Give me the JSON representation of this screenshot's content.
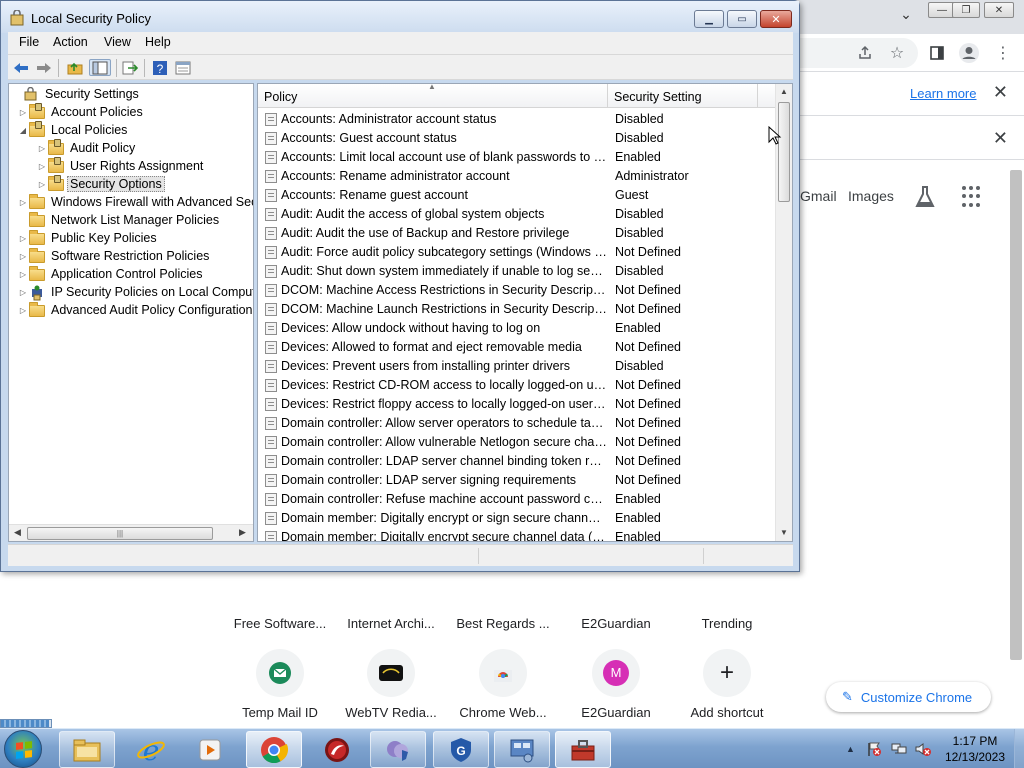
{
  "chrome": {
    "learn_more": "Learn more",
    "gmail": "Gmail",
    "images": "Images",
    "shortcuts": [
      {
        "label": "Free Software..."
      },
      {
        "label": "Internet Archi..."
      },
      {
        "label": "Best Regards ..."
      },
      {
        "label": "E2Guardian"
      },
      {
        "label": "Trending"
      },
      {
        "label": "Temp Mail ID"
      },
      {
        "label": "WebTV Redia..."
      },
      {
        "label": "Chrome Web..."
      },
      {
        "label": "E2Guardian",
        "initial": "M"
      },
      {
        "label": "Add shortcut",
        "icon": "+"
      }
    ],
    "customize": "Customize Chrome"
  },
  "mmc": {
    "title": "Local Security Policy",
    "menu": [
      "File",
      "Action",
      "View",
      "Help"
    ],
    "tree": [
      {
        "label": "Security Settings",
        "arrow": "◢",
        "icon": "root-icon"
      },
      {
        "label": "Account Policies",
        "arrow": "▷",
        "icon": "folder-icon"
      },
      {
        "label": "Local Policies",
        "arrow": "◢",
        "icon": "folder-icon"
      },
      {
        "label": "Audit Policy",
        "arrow": "▷",
        "icon": "folder-icon"
      },
      {
        "label": "User Rights Assignment",
        "arrow": "▷",
        "icon": "folder-icon"
      },
      {
        "label": "Security Options",
        "arrow": "▷",
        "icon": "folder-icon",
        "selected": true
      },
      {
        "label": "Windows Firewall with Advanced Securi",
        "arrow": "▷",
        "icon": "folder-icon"
      },
      {
        "label": "Network List Manager Policies",
        "arrow": "",
        "icon": "folder-icon"
      },
      {
        "label": "Public Key Policies",
        "arrow": "▷",
        "icon": "folder-icon"
      },
      {
        "label": "Software Restriction Policies",
        "arrow": "▷",
        "icon": "folder-icon"
      },
      {
        "label": "Application Control Policies",
        "arrow": "▷",
        "icon": "folder-icon"
      },
      {
        "label": "IP Security Policies on Local Compute",
        "arrow": "▷",
        "icon": "ipsec-icon"
      },
      {
        "label": "Advanced Audit Policy Configuration",
        "arrow": "▷",
        "icon": "folder-icon"
      }
    ],
    "columns": {
      "policy": "Policy",
      "setting": "Security Setting"
    },
    "rows": [
      {
        "policy": "Accounts: Administrator account status",
        "setting": "Disabled"
      },
      {
        "policy": "Accounts: Guest account status",
        "setting": "Disabled"
      },
      {
        "policy": "Accounts: Limit local account use of blank passwords to co...",
        "setting": "Enabled"
      },
      {
        "policy": "Accounts: Rename administrator account",
        "setting": "Administrator"
      },
      {
        "policy": "Accounts: Rename guest account",
        "setting": "Guest"
      },
      {
        "policy": "Audit: Audit the access of global system objects",
        "setting": "Disabled"
      },
      {
        "policy": "Audit: Audit the use of Backup and Restore privilege",
        "setting": "Disabled"
      },
      {
        "policy": "Audit: Force audit policy subcategory settings (Windows Vis...",
        "setting": "Not Defined"
      },
      {
        "policy": "Audit: Shut down system immediately if unable to log secur...",
        "setting": "Disabled"
      },
      {
        "policy": "DCOM: Machine Access Restrictions in Security Descriptor D...",
        "setting": "Not Defined"
      },
      {
        "policy": "DCOM: Machine Launch Restrictions in Security Descriptor ...",
        "setting": "Not Defined"
      },
      {
        "policy": "Devices: Allow undock without having to log on",
        "setting": "Enabled"
      },
      {
        "policy": "Devices: Allowed to format and eject removable media",
        "setting": "Not Defined"
      },
      {
        "policy": "Devices: Prevent users from installing printer drivers",
        "setting": "Disabled"
      },
      {
        "policy": "Devices: Restrict CD-ROM access to locally logged-on user ...",
        "setting": "Not Defined"
      },
      {
        "policy": "Devices: Restrict floppy access to locally logged-on user only",
        "setting": "Not Defined"
      },
      {
        "policy": "Domain controller: Allow server operators to schedule tasks",
        "setting": "Not Defined"
      },
      {
        "policy": "Domain controller: Allow vulnerable Netlogon secure chann...",
        "setting": "Not Defined"
      },
      {
        "policy": "Domain controller: LDAP server channel binding token requi...",
        "setting": "Not Defined"
      },
      {
        "policy": "Domain controller: LDAP server signing requirements",
        "setting": "Not Defined"
      },
      {
        "policy": "Domain controller: Refuse machine account password chan...",
        "setting": "Enabled"
      },
      {
        "policy": "Domain member: Digitally encrypt or sign secure channel d...",
        "setting": "Enabled"
      },
      {
        "policy": "Domain member: Digitally encrypt secure channel data (wh...",
        "setting": "Enabled"
      }
    ]
  },
  "taskbar": {
    "apps": [
      "file-explorer-icon",
      "internet-explorer-icon",
      "media-player-icon",
      "chrome-icon",
      "app-red-icon",
      "app-purple-icon",
      "guardian-icon",
      "network-icon",
      "toolbox-icon"
    ],
    "time": "1:17 PM",
    "date": "12/13/2023"
  },
  "colors": {
    "accent": "#1a73e8",
    "mmc_frame": "#c7d9ee",
    "taskbar": "#7ea3cf"
  }
}
